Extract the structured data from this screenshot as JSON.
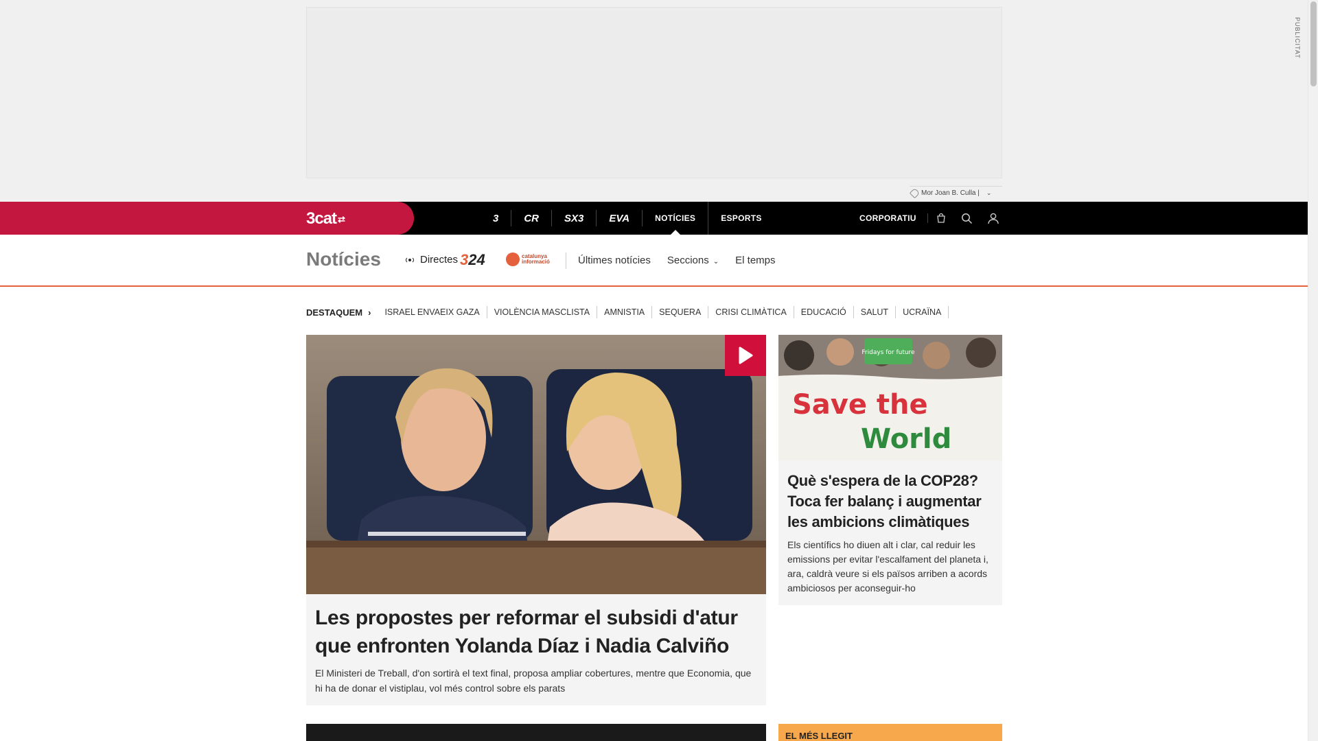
{
  "ad": {
    "label": "PUBLICITAT",
    "tag_text": "Mor Joan B. Culla |"
  },
  "topbar": {
    "brand": "3cat",
    "brand_sub": "⇄",
    "channels": [
      {
        "label": "3",
        "name": "channel-tv3"
      },
      {
        "label": "CR",
        "name": "channel-catradio"
      },
      {
        "label": "SX3",
        "name": "channel-sx3"
      },
      {
        "label": "EVA",
        "name": "channel-eva"
      }
    ],
    "noticies": "NOTÍCIES",
    "esports": "ESPORTS",
    "corporatiu": "CORPORATIU"
  },
  "section": {
    "title": "Notícies",
    "directes": "Directes",
    "logo_324_a": "3",
    "logo_324_b": "24",
    "catinfo_a": "catalunya",
    "catinfo_b": "informació",
    "nav": {
      "ultimes": "Últimes notícies",
      "seccions": "Seccions",
      "temps": "El temps"
    }
  },
  "destaquem": {
    "label": "DESTAQUEM",
    "tags": [
      "ISRAEL ENVAEIX GAZA",
      "VIOLÈNCIA MASCLISTA",
      "AMNISTIA",
      "SEQUERA",
      "CRISI CLIMÀTICA",
      "EDUCACIÓ",
      "SALUT",
      "UCRAÏNA"
    ]
  },
  "main_article": {
    "title": "Les propostes per reformar el subsidi d'atur que enfronten Yolanda Díaz i Nadia Calviño",
    "lead": "El Ministeri de Treball, d'on sortirà el text final, proposa ampliar cobertures, mentre que Economia, que hi ha de donar el vistiplau, vol més control sobre els parats"
  },
  "side_article": {
    "title": "Què s'espera de la COP28? Toca fer balanç i augmentar les ambicions climàtiques",
    "lead": "Els científics ho diuen alt i clar, cal reduir les emissions per evitar l'escalfament del planeta i, ara, caldrà veure si els països arriben a acords ambiciosos per aconseguir-ho",
    "banner_a": "Save the",
    "banner_b": "World",
    "sign": "Fridays for future"
  },
  "bottom": {
    "mes_llegit": "EL MÉS LLEGIT"
  },
  "colors": {
    "brand_red": "#c4173f",
    "accent_orange": "#e5603c",
    "play_red": "#d0103a",
    "mes_llegit_bg": "#f7a84c"
  }
}
